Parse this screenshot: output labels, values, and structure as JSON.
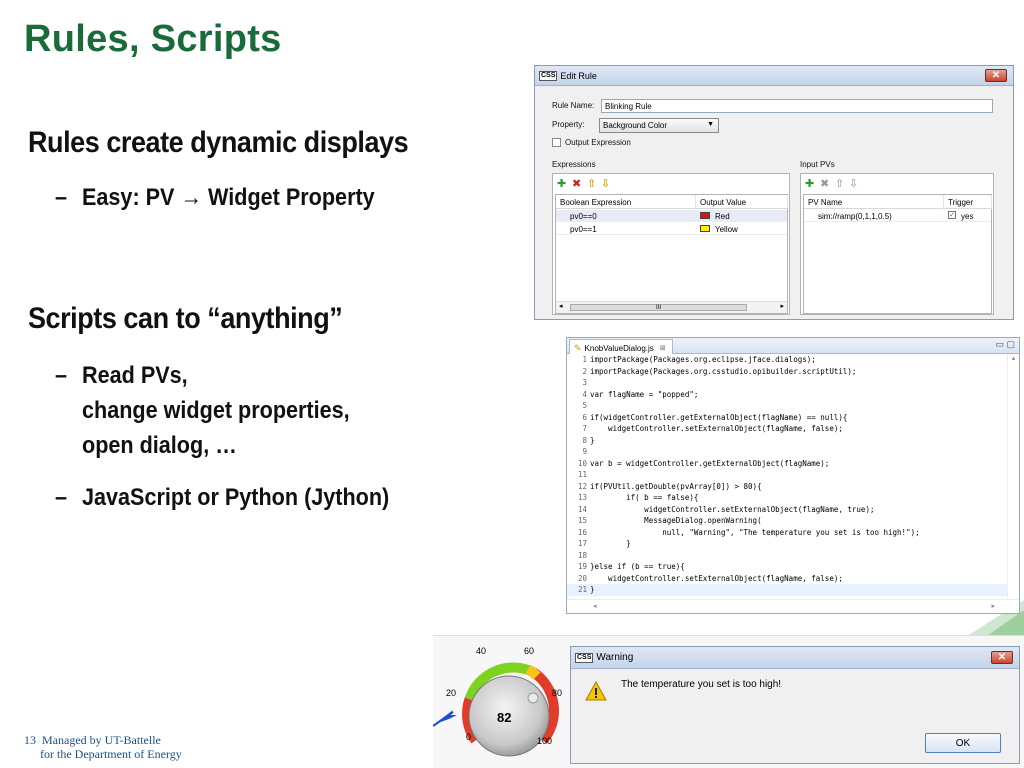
{
  "slide": {
    "title": "Rules, Scripts",
    "bullet1": "Rules create dynamic displays",
    "bullet1_sub1": "Easy: PV → Widget Property",
    "bullet2": "Scripts can to “anything”",
    "bullet2_sub1_line1": "Read PVs,",
    "bullet2_sub1_line2": "change widget properties,",
    "bullet2_sub1_line3": "open dialog, …",
    "bullet2_sub2": "JavaScript or Python (Jython)",
    "dash": "–",
    "page_number": "13",
    "footer_line1": "Managed by UT-Battelle",
    "footer_line2": "for the Department of Energy",
    "title_color": "#1a6b3a"
  },
  "edit_rule": {
    "logo": "CSS",
    "title": "Edit Rule",
    "close": "✕",
    "rule_name_label": "Rule Name:",
    "rule_name_value": "Blinking Rule",
    "property_label": "Property:",
    "property_value": "Background Color",
    "output_expression_label": "Output Expression",
    "expressions_label": "Expressions",
    "input_pvs_label": "Input PVs",
    "expr_columns": [
      "Boolean Expression",
      "Output Value"
    ],
    "expr_rows": [
      {
        "expr": "pv0==0",
        "value": "Red",
        "color": "#dd1111"
      },
      {
        "expr": "pv0==1",
        "value": "Yellow",
        "color": "#ffee00"
      }
    ],
    "pv_columns": [
      "PV Name",
      "Trigger"
    ],
    "pv_rows": [
      {
        "name": "sim://ramp(0,1,1,0.5)",
        "trigger": "yes"
      }
    ],
    "scroll_grip": "III"
  },
  "editor": {
    "tab_label": "KnobValueDialog.js",
    "lines": [
      "importPackage(Packages.org.eclipse.jface.dialogs);",
      "importPackage(Packages.org.csstudio.opibuilder.scriptUtil);",
      "",
      "var flagName = \"popped\";",
      "",
      "if(widgetController.getExternalObject(flagName) == null){",
      "    widgetController.setExternalObject(flagName, false);",
      "}",
      "",
      "var b = widgetController.getExternalObject(flagName);",
      "",
      "if(PVUtil.getDouble(pvArray[0]) > 80){",
      "        if( b == false){",
      "            widgetController.setExternalObject(flagName, true);",
      "            MessageDialog.openWarning(",
      "                null, \"Warning\", \"The temperature you set is too high!\");",
      "        }",
      "",
      "}else if (b == true){",
      "    widgetController.setExternalObject(flagName, false);",
      "}"
    ]
  },
  "knob": {
    "value": "82",
    "scale_labels": [
      "0",
      "20",
      "40",
      "60",
      "80",
      "100"
    ],
    "min": 0,
    "max": 100
  },
  "warning": {
    "logo": "CSS",
    "title": "Warning",
    "message": "The temperature you set is too high!",
    "ok_label": "OK",
    "close": "✕"
  }
}
